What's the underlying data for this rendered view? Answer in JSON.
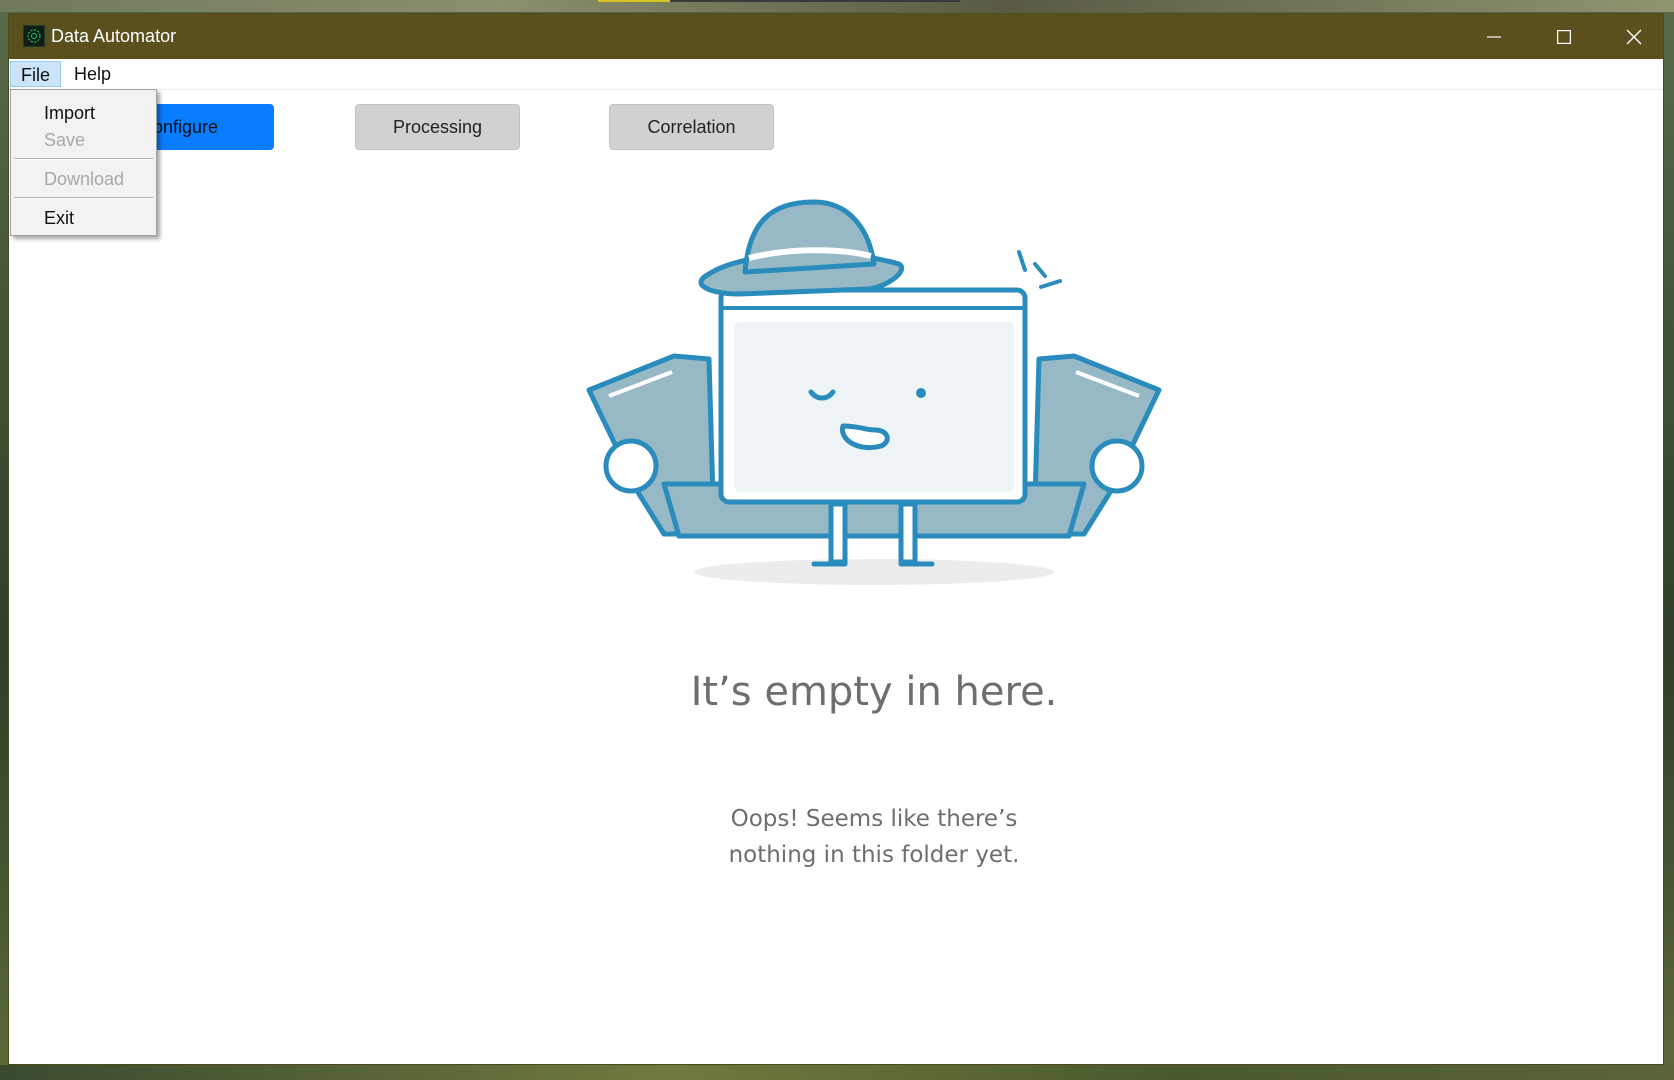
{
  "window": {
    "title": "Data Automator",
    "app_icon": "data-automator-app-icon",
    "controls": [
      "minimize-icon",
      "maximize-icon",
      "close-icon"
    ],
    "titlebar_color": "#59501e"
  },
  "menubar": {
    "items": [
      {
        "label": "File",
        "active": true
      },
      {
        "label": "Help",
        "active": false
      }
    ]
  },
  "file_menu": {
    "items": [
      {
        "label": "Import",
        "enabled": true
      },
      {
        "label": "Save",
        "enabled": false
      },
      {
        "label": "Download",
        "enabled": false
      },
      {
        "label": "Exit",
        "enabled": true
      }
    ]
  },
  "tabs": {
    "configure": {
      "label": "Configure",
      "active": true,
      "color": "#0a7cff"
    },
    "processing": {
      "label": "Processing",
      "active": false
    },
    "correlation": {
      "label": "Correlation",
      "active": false
    }
  },
  "empty_state": {
    "illustration": "folder-character-with-hat-icon",
    "title": "It’s empty in here.",
    "subtitle_line1": "Oops! Seems like there’s",
    "subtitle_line2": "nothing in this folder yet."
  }
}
